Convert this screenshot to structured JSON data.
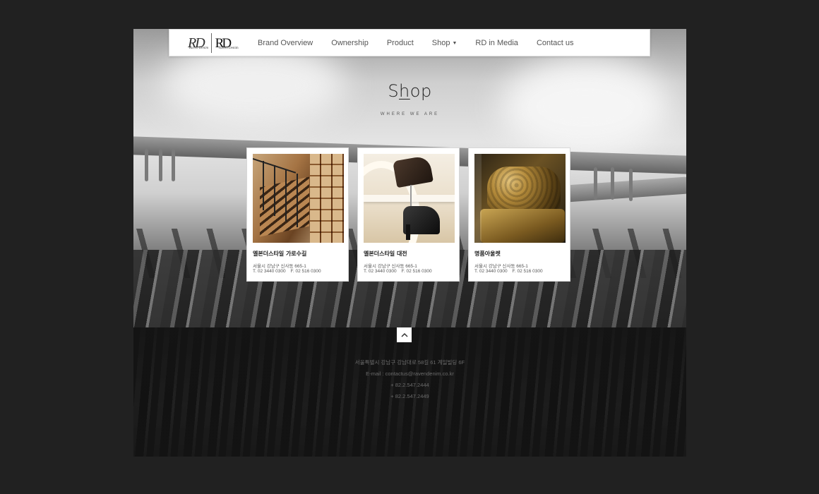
{
  "logo": {
    "monogram_left": "RD",
    "caption_left": "Raven Denim",
    "monogram_right": "RD",
    "caption_right": "Raven Denim"
  },
  "nav": {
    "items": [
      {
        "label": "Brand Overview"
      },
      {
        "label": "Ownership"
      },
      {
        "label": "Product"
      },
      {
        "label": "Shop"
      },
      {
        "label": "RD in Media"
      },
      {
        "label": "Contact us"
      }
    ]
  },
  "hero": {
    "title_pre": "S",
    "title_underlined": "h",
    "title_post": "op",
    "subtitle": "WHERE WE ARE"
  },
  "shops": [
    {
      "name": "엘본더스타일 가로수길",
      "address": "서울시 강남구 신사동 665-1",
      "tel": "T. 02 3440 0300",
      "fax": "F. 02 516 0300"
    },
    {
      "name": "엘본더스타일 대전",
      "address": "서울시 강남구 신사동 665-1",
      "tel": "T. 02 3440 0300",
      "fax": "F. 02 516 0300"
    },
    {
      "name": "명품아울렛",
      "address": "서울시 강남구 신사동 665-1",
      "tel": "T. 02 3440 0300",
      "fax": "F. 02 516 0300"
    }
  ],
  "footer": {
    "address": "서울특별시 강남구 강남대로 58길 61 계일빌딩 6F",
    "email": "E-mail : contactus@ravendenim.co.kr",
    "phone1": "+ 82.2.547.2444",
    "phone2": "+ 82.2.547.2449"
  },
  "icons": {
    "to_top": "chevron-up-icon",
    "shop_dropdown": "caret-down-icon"
  }
}
